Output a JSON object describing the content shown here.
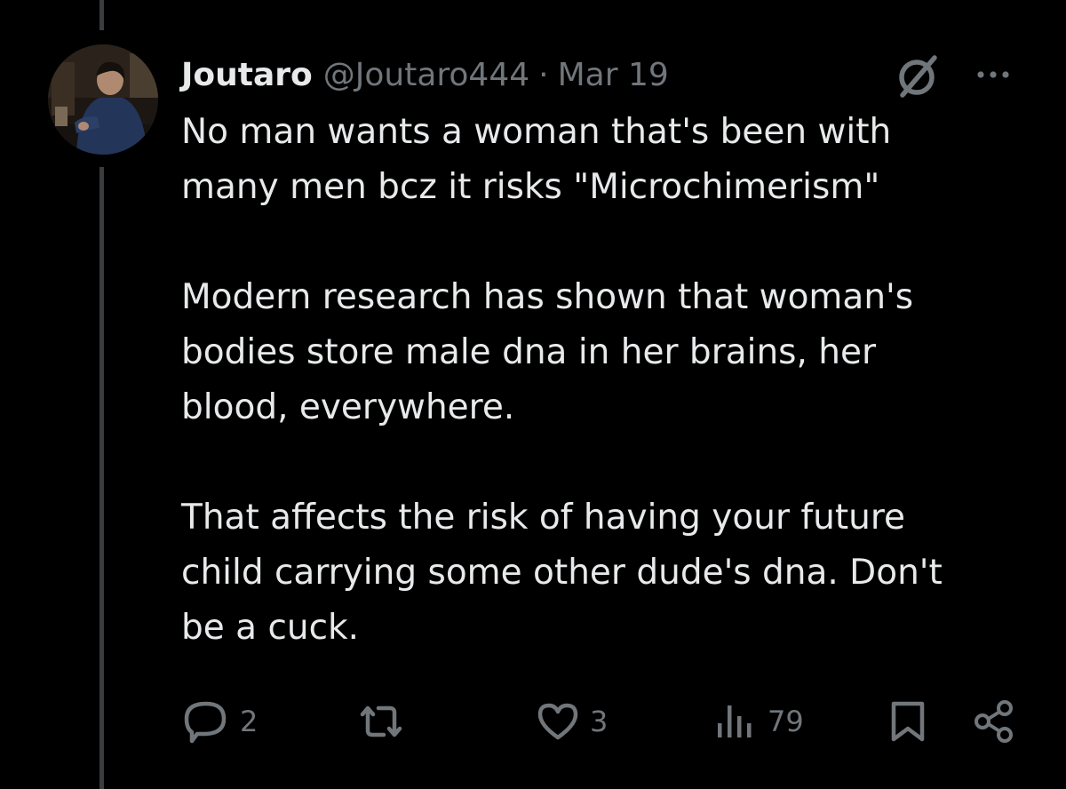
{
  "tweet": {
    "display_name": "Joutaro",
    "handle": "@Joutaro444",
    "separator": "·",
    "date": "Mar 19",
    "paragraphs": [
      "No man wants a woman that's been with\nmany men bcz it risks \"Microchimerism\"",
      "Modern research has shown that woman's\nbodies store male dna in her brains, her\nblood, everywhere.",
      "That affects the risk of having your future\nchild carrying some other dude's dna. Don't\nbe a cuck."
    ]
  },
  "actions": {
    "replies": "2",
    "likes": "3",
    "views": "79"
  },
  "icons": {
    "reply": "reply-icon",
    "retweet": "retweet-icon",
    "like": "heart-icon",
    "views": "views-icon",
    "bookmark": "bookmark-icon",
    "share": "share-icon",
    "grok": "grok-icon",
    "more": "more-icon"
  },
  "colors": {
    "background": "#000000",
    "text_primary": "#e7e9ea",
    "text_secondary": "#71767b",
    "thread_line": "#3a3d40"
  }
}
